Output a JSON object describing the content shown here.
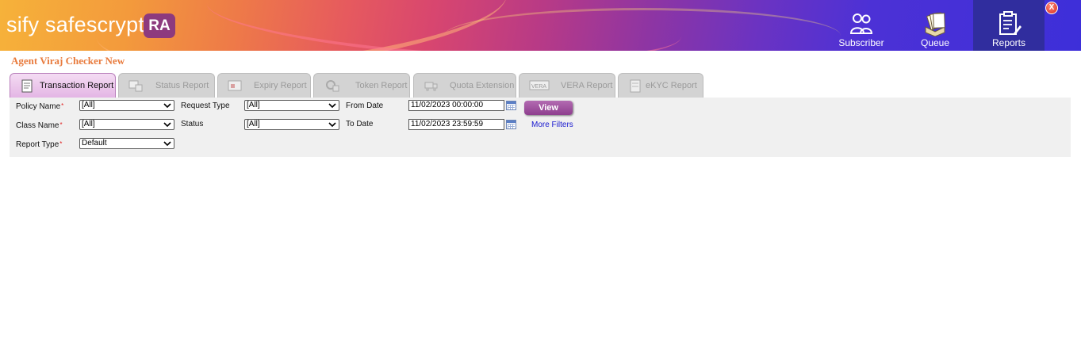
{
  "header": {
    "logo_text": "sify safescrypt",
    "logo_badge": "RA",
    "nav": [
      {
        "label": "Subscriber",
        "icon": "users-icon"
      },
      {
        "label": "Queue",
        "icon": "queue-stack-icon"
      },
      {
        "label": "Reports",
        "icon": "report-clipboard-icon",
        "active": true
      }
    ],
    "close_label": "X"
  },
  "page_title": "Agent Viraj Checker New",
  "tabs": [
    {
      "label": "Transaction Report",
      "active": true
    },
    {
      "label": "Status Report"
    },
    {
      "label": "Expiry Report"
    },
    {
      "label": "Token Report"
    },
    {
      "label": "Quota Extension"
    },
    {
      "label": "VERA Report"
    },
    {
      "label": "eKYC Report"
    }
  ],
  "filters": {
    "policy_name": {
      "label": "Policy Name",
      "value": "[All]"
    },
    "class_name": {
      "label": "Class Name",
      "value": "[All]"
    },
    "report_type": {
      "label": "Report Type",
      "value": "Default"
    },
    "request_type": {
      "label": "Request Type",
      "value": "[All]"
    },
    "status": {
      "label": "Status",
      "value": "[All]"
    },
    "from_date": {
      "label": "From Date",
      "value": "11/02/2023  00:00:00"
    },
    "to_date": {
      "label": "To Date",
      "value": "11/02/2023  23:59:59"
    },
    "required_marker": "*",
    "view_button": "View",
    "more_filters": "More Filters"
  },
  "colors": {
    "title": "#e87a3c",
    "active_tab": "#e3b4e4",
    "view_button": "#9a4a9a",
    "link": "#1a1ad0",
    "nav_active": "#302d9e"
  }
}
